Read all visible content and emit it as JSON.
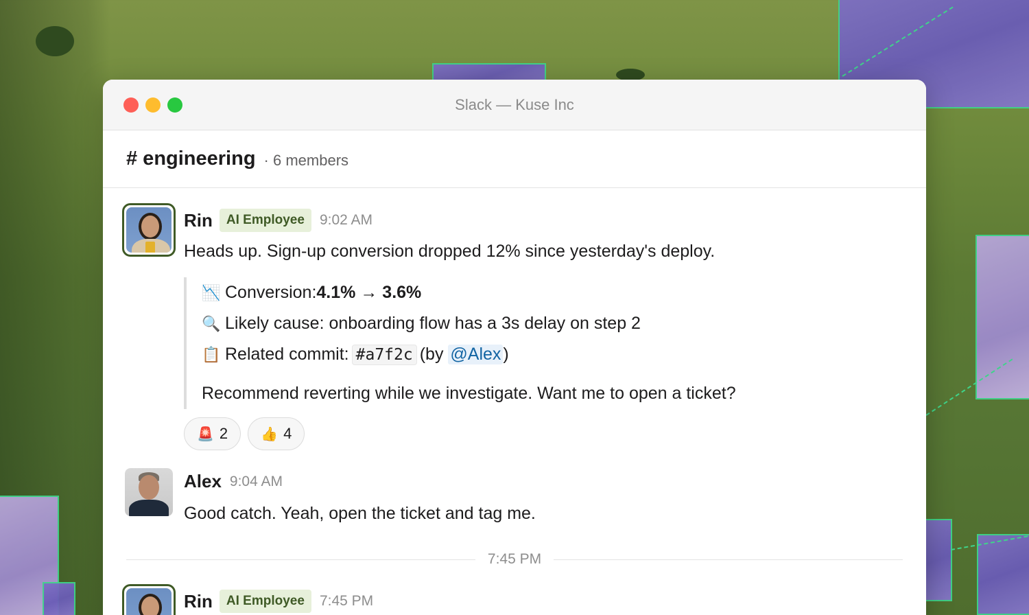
{
  "window": {
    "title": "Slack — Kuse Inc"
  },
  "channel": {
    "name": "# engineering",
    "members": "· 6 members"
  },
  "messages": [
    {
      "author": "Rin",
      "badge": "AI Employee",
      "time": "9:02 AM",
      "text": "Heads up. Sign-up conversion dropped 12% since yesterday's deploy.",
      "details": {
        "conversion_label": "Conversion: ",
        "conversion_from": "4.1%",
        "conversion_arrow": " → ",
        "conversion_to": "3.6%",
        "cause": "Likely cause: onboarding flow has a 3s delay on step 2",
        "commit_label": "Related commit:",
        "commit_hash": "#a7f2c",
        "commit_by_prefix": "(by ",
        "commit_mention": "@Alex",
        "commit_by_suffix": ")",
        "recommendation": "Recommend reverting while we investigate. Want me to open a ticket?"
      },
      "reactions": [
        {
          "emoji": "🚨",
          "count": "2"
        },
        {
          "emoji": "👍",
          "count": "4"
        }
      ]
    },
    {
      "author": "Alex",
      "time": "9:04 AM",
      "text": "Good catch. Yeah, open the ticket and tag me."
    },
    {
      "author": "Rin",
      "badge": "AI Employee",
      "time": "7:45 PM"
    }
  ],
  "divider": {
    "time": "7:45 PM"
  },
  "icons": {
    "chart_down": "chart-decreasing-icon",
    "magnifier": "magnifying-glass-icon",
    "clipboard": "clipboard-icon"
  },
  "colors": {
    "ai_badge_bg": "#e7f0da",
    "ai_badge_text": "#3f5a26",
    "mention": "#1264a3",
    "traffic_red": "#fe5f57",
    "traffic_yellow": "#febc2e",
    "traffic_green": "#28c840"
  }
}
